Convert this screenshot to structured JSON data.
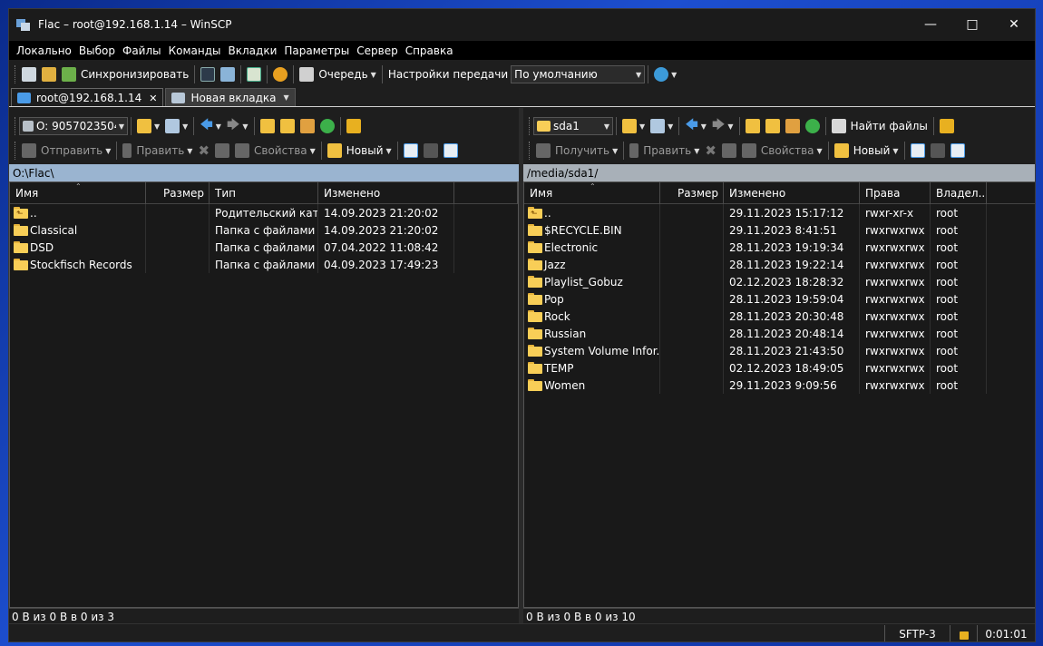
{
  "window": {
    "title": "Flac – root@192.168.1.14 – WinSCP"
  },
  "menu": [
    "Локально",
    "Выбор",
    "Файлы",
    "Команды",
    "Вкладки",
    "Параметры",
    "Сервер",
    "Справка"
  ],
  "toolbar": {
    "sync_label": "Синхронизировать",
    "queue_label": "Очередь",
    "transfer_settings_label": "Настройки передачи",
    "transfer_preset": "По умолчанию"
  },
  "tabs": {
    "active": "root@192.168.1.14",
    "new_tab": "Новая вкладка"
  },
  "left": {
    "drive": "O: 9057023504@i",
    "send_label": "Отправить",
    "edit_label": "Править",
    "props_label": "Свойства",
    "new_label": "Новый",
    "path": "O:\\Flac\\",
    "columns": {
      "name": "Имя",
      "size": "Размер",
      "type": "Тип",
      "changed": "Изменено"
    },
    "rows": [
      {
        "name": "..",
        "type": "Родительский кат...",
        "changed": "14.09.2023 21:20:02",
        "up": true
      },
      {
        "name": "Classical",
        "type": "Папка с файлами",
        "changed": "14.09.2023 21:20:02"
      },
      {
        "name": "DSD",
        "type": "Папка с файлами",
        "changed": "07.04.2022 11:08:42"
      },
      {
        "name": "Stockfisch Records",
        "type": "Папка с файлами",
        "changed": "04.09.2023 17:49:23"
      }
    ],
    "status": "0 B из 0 B в 0 из 3"
  },
  "right": {
    "drive": "sda1",
    "find_label": "Найти файлы",
    "get_label": "Получить",
    "edit_label": "Править",
    "props_label": "Свойства",
    "new_label": "Новый",
    "path": "/media/sda1/",
    "columns": {
      "name": "Имя",
      "size": "Размер",
      "changed": "Изменено",
      "rights": "Права",
      "owner": "Владел..."
    },
    "rows": [
      {
        "name": "..",
        "changed": "29.11.2023 15:17:12",
        "rights": "rwxr-xr-x",
        "owner": "root"
      },
      {
        "name": "$RECYCLE.BIN",
        "changed": "29.11.2023 8:41:51",
        "rights": "rwxrwxrwx",
        "owner": "root"
      },
      {
        "name": "Electronic",
        "changed": "28.11.2023 19:19:34",
        "rights": "rwxrwxrwx",
        "owner": "root"
      },
      {
        "name": "Jazz",
        "changed": "28.11.2023 19:22:14",
        "rights": "rwxrwxrwx",
        "owner": "root"
      },
      {
        "name": "Playlist_Gobuz",
        "changed": "02.12.2023 18:28:32",
        "rights": "rwxrwxrwx",
        "owner": "root"
      },
      {
        "name": "Pop",
        "changed": "28.11.2023 19:59:04",
        "rights": "rwxrwxrwx",
        "owner": "root"
      },
      {
        "name": "Rock",
        "changed": "28.11.2023 20:30:48",
        "rights": "rwxrwxrwx",
        "owner": "root"
      },
      {
        "name": "Russian",
        "changed": "28.11.2023 20:48:14",
        "rights": "rwxrwxrwx",
        "owner": "root"
      },
      {
        "name": "System Volume Infor...",
        "changed": "28.11.2023 21:43:50",
        "rights": "rwxrwxrwx",
        "owner": "root"
      },
      {
        "name": "TEMP",
        "changed": "02.12.2023 18:49:05",
        "rights": "rwxrwxrwx",
        "owner": "root"
      },
      {
        "name": "Women",
        "changed": "29.11.2023 9:09:56",
        "rights": "rwxrwxrwx",
        "owner": "root"
      }
    ],
    "status": "0 B из 0 B в 0 из 10"
  },
  "bottom": {
    "protocol": "SFTP-3",
    "elapsed": "0:01:01"
  },
  "colors": {
    "folder": "#f8ce57",
    "path_left": "#9ab4d0",
    "path_right": "#a8b0b8",
    "accent": "#4a9be8"
  }
}
